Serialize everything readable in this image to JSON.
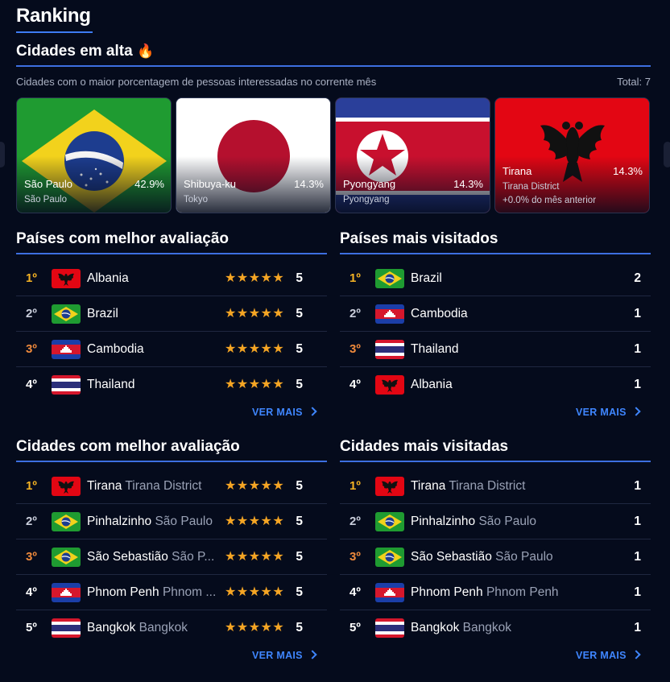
{
  "page": {
    "title": "Ranking"
  },
  "trending": {
    "title": "Cidades em alta",
    "emoji": "🔥",
    "subtitle": "Cidades com o maior porcentagem de pessoas interessadas no corrente mês",
    "total": "Total: 7",
    "cards": [
      {
        "name": "São Paulo",
        "pct": "42.9%",
        "sub": "São Paulo",
        "flag": "brazil"
      },
      {
        "name": "Shibuya-ku",
        "pct": "14.3%",
        "sub": "Tokyo",
        "flag": "japan"
      },
      {
        "name": "Pyongyang",
        "pct": "14.3%",
        "sub": "Pyongyang",
        "flag": "north-korea"
      },
      {
        "name": "Tirana",
        "pct": "14.3%",
        "sub": "Tirana District",
        "sub2": "+0.0% do mês anterior",
        "flag": "albania"
      }
    ]
  },
  "best_countries": {
    "title": "Países com melhor avaliação",
    "ver_mais": "VER MAIS",
    "rows": [
      {
        "rank": "1º",
        "name": "Albania",
        "stars": "★★★★★",
        "score": "5",
        "flag": "albania"
      },
      {
        "rank": "2º",
        "name": "Brazil",
        "stars": "★★★★★",
        "score": "5",
        "flag": "brazil"
      },
      {
        "rank": "3º",
        "name": "Cambodia",
        "stars": "★★★★★",
        "score": "5",
        "flag": "cambodia"
      },
      {
        "rank": "4º",
        "name": "Thailand",
        "stars": "★★★★★",
        "score": "5",
        "flag": "thailand"
      }
    ]
  },
  "visited_countries": {
    "title": "Países mais visitados",
    "ver_mais": "VER MAIS",
    "rows": [
      {
        "rank": "1º",
        "name": "Brazil",
        "score": "2",
        "flag": "brazil"
      },
      {
        "rank": "2º",
        "name": "Cambodia",
        "score": "1",
        "flag": "cambodia"
      },
      {
        "rank": "3º",
        "name": "Thailand",
        "score": "1",
        "flag": "thailand"
      },
      {
        "rank": "4º",
        "name": "Albania",
        "score": "1",
        "flag": "albania"
      }
    ]
  },
  "best_cities": {
    "title": "Cidades com melhor avaliação",
    "ver_mais": "VER MAIS",
    "rows": [
      {
        "rank": "1º",
        "name": "Tirana",
        "region": "Tirana District",
        "stars": "★★★★★",
        "score": "5",
        "flag": "albania"
      },
      {
        "rank": "2º",
        "name": "Pinhalzinho",
        "region": "São Paulo",
        "stars": "★★★★★",
        "score": "5",
        "flag": "brazil"
      },
      {
        "rank": "3º",
        "name": "São Sebastião",
        "region": "São P...",
        "stars": "★★★★★",
        "score": "5",
        "flag": "brazil"
      },
      {
        "rank": "4º",
        "name": "Phnom Penh",
        "region": "Phnom ...",
        "stars": "★★★★★",
        "score": "5",
        "flag": "cambodia"
      },
      {
        "rank": "5º",
        "name": "Bangkok",
        "region": "Bangkok",
        "stars": "★★★★★",
        "score": "5",
        "flag": "thailand"
      }
    ]
  },
  "visited_cities": {
    "title": "Cidades mais visitadas",
    "ver_mais": "VER MAIS",
    "rows": [
      {
        "rank": "1º",
        "name": "Tirana",
        "region": "Tirana District",
        "score": "1",
        "flag": "albania"
      },
      {
        "rank": "2º",
        "name": "Pinhalzinho",
        "region": "São Paulo",
        "score": "1",
        "flag": "brazil"
      },
      {
        "rank": "3º",
        "name": "São Sebastião",
        "region": "São Paulo",
        "score": "1",
        "flag": "brazil"
      },
      {
        "rank": "4º",
        "name": "Phnom Penh",
        "region": "Phnom Penh",
        "score": "1",
        "flag": "cambodia"
      },
      {
        "rank": "5º",
        "name": "Bangkok",
        "region": "Bangkok",
        "score": "1",
        "flag": "thailand"
      }
    ]
  },
  "colors": {
    "accent": "#3d7cf4",
    "gold": "#f5b324",
    "silver": "#c9cedb",
    "bronze": "#f08a3c",
    "star": "#f5a524",
    "background": "#050b1c"
  }
}
